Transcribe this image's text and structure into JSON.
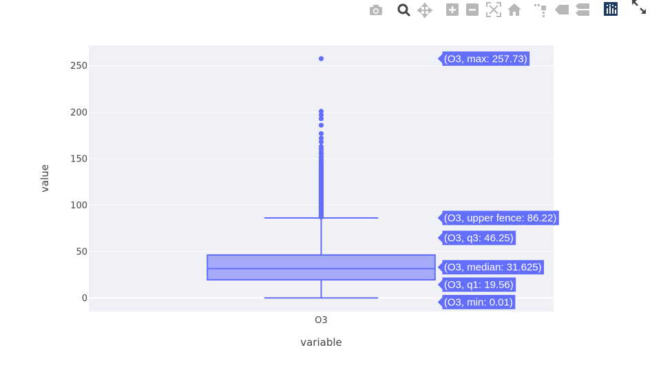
{
  "toolbar": {
    "buttons": [
      {
        "name": "camera-icon",
        "title": "Download plot as a png"
      },
      {
        "name": "zoom-icon",
        "title": "Zoom"
      },
      {
        "name": "pan-icon",
        "title": "Pan"
      },
      {
        "name": "zoom-in-icon",
        "title": "Zoom in"
      },
      {
        "name": "zoom-out-icon",
        "title": "Zoom out"
      },
      {
        "name": "autoscale-icon",
        "title": "Autoscale"
      },
      {
        "name": "home-icon",
        "title": "Reset axes"
      },
      {
        "name": "spike-lines-icon",
        "title": "Toggle Spike Lines"
      },
      {
        "name": "hover-closest-icon",
        "title": "Show closest data on hover"
      },
      {
        "name": "hover-compare-icon",
        "title": "Compare data on hover"
      },
      {
        "name": "plotly-logo-icon",
        "title": "Produced with Plotly"
      },
      {
        "name": "fullscreen-icon",
        "title": "Fullscreen"
      }
    ]
  },
  "chart_data": {
    "type": "box",
    "xlabel": "variable",
    "ylabel": "value",
    "categories": [
      "O3"
    ],
    "ylim": [
      -14.5,
      272
    ],
    "yticks": [
      0,
      50,
      100,
      150,
      200,
      250
    ],
    "grid": true,
    "colors": {
      "box_line": "#636efa",
      "box_fill": "#a5aaf8",
      "plot_bg": "#eff1f6",
      "grid": "#ffffff",
      "label_bg": "#636efa"
    },
    "series": [
      {
        "category": "O3",
        "min": 0.01,
        "q1": 19.56,
        "median": 31.625,
        "q3": 46.25,
        "upper_fence": 86.22,
        "max": 257.73,
        "outliers": [
          87,
          88,
          89,
          90,
          91,
          92,
          93,
          94,
          95,
          96,
          97,
          98,
          99,
          100,
          101,
          102,
          103,
          104,
          105,
          106,
          107,
          108,
          109,
          110,
          111,
          112,
          113,
          114,
          115,
          116,
          117,
          118,
          119,
          120,
          121,
          122,
          123,
          124,
          125,
          126,
          127,
          128,
          129,
          130,
          131,
          132,
          133,
          134,
          135,
          136,
          137,
          138,
          139,
          140,
          142,
          144,
          146,
          148,
          150,
          152,
          155,
          157,
          160,
          163,
          168,
          172,
          177,
          186,
          193,
          197,
          201,
          257.73
        ]
      }
    ],
    "hover_labels": [
      "(O3, max: 257.73)",
      "(O3, upper fence: 86.22)",
      "(O3, q3: 46.25)",
      "(O3, median: 31.625)",
      "(O3, q1: 19.56)",
      "(O3, min: 0.01)"
    ]
  }
}
